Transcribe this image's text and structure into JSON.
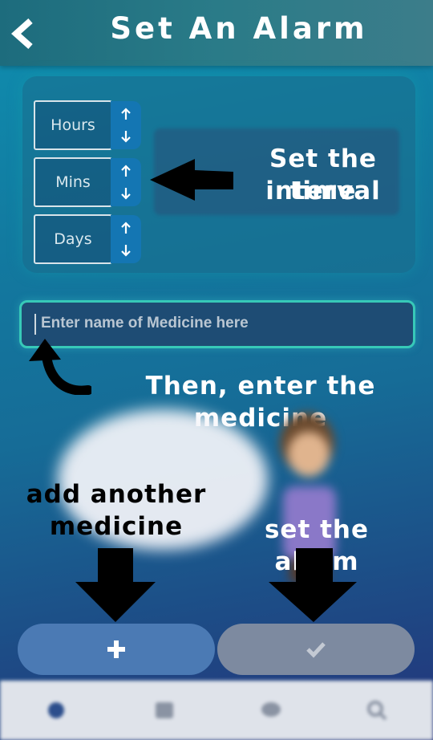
{
  "header": {
    "title": "Set An Alarm",
    "back_icon": "chevron-left-icon"
  },
  "interval": {
    "fields": [
      {
        "label": "Hours"
      },
      {
        "label": "Mins"
      },
      {
        "label": "Days"
      }
    ]
  },
  "medicine_input": {
    "placeholder": "Enter name of Medicine here",
    "value": ""
  },
  "annotations": {
    "time_interval_1": "Set the time",
    "time_interval_2": "interval",
    "enter_medicine": "Then, enter the medicine",
    "add_another_1": "add another",
    "add_another_2": "medicine",
    "set_alarm": "set the alarm"
  },
  "buttons": {
    "add": {
      "icon": "plus-icon"
    },
    "set": {
      "icon": "check-icon"
    }
  },
  "bottom_nav": {
    "icons": [
      "home-icon",
      "calendar-icon",
      "chat-icon",
      "search-icon"
    ]
  },
  "colors": {
    "input_border": "#37c9b8",
    "stepper_blue": "#1476b3",
    "add_button": "#4b7ab4",
    "set_button": "#7d8aa0"
  }
}
